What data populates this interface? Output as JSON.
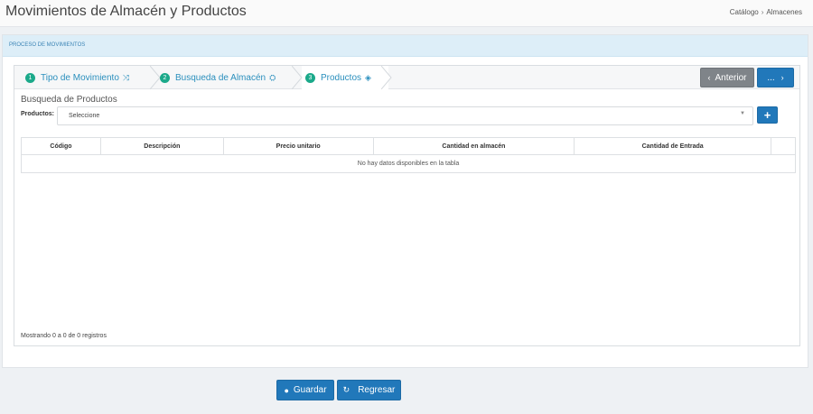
{
  "header": {
    "title": "Movimientos de Almacén y Productos",
    "breadcrumb": [
      "Catálogo",
      "Almacenes"
    ]
  },
  "panel": {
    "title": "PROCESO DE MOVIMIENTOS"
  },
  "wizard": {
    "steps": [
      {
        "num": "1",
        "label": "Tipo de Movimiento",
        "icon": "shuffle-icon"
      },
      {
        "num": "2",
        "label": "Busqueda de Almacén",
        "icon": "cubes-icon"
      },
      {
        "num": "3",
        "label": "Productos",
        "icon": "cube-icon",
        "active": true
      }
    ],
    "prev_label": "Anterior",
    "next_label": "..."
  },
  "products": {
    "section_title": "Busqueda de Productos",
    "field_label": "Productos:",
    "select_value": "Seleccione",
    "add_label": "+"
  },
  "table": {
    "columns": [
      "Código",
      "Descripción",
      "Precio unitario",
      "Cantidad en almacén",
      "Cantidad de Entrada",
      ""
    ],
    "empty_message": "No hay datos disponibles en la tabla",
    "info": "Mostrando 0 a 0 de 0 registros"
  },
  "footer": {
    "save_label": "Guardar",
    "back_label": "Regresar"
  },
  "colors": {
    "primary": "#2178ba",
    "step_badge": "#1ba98a",
    "step_text": "#2a8fbd",
    "panel_header": "#ddeef8"
  }
}
